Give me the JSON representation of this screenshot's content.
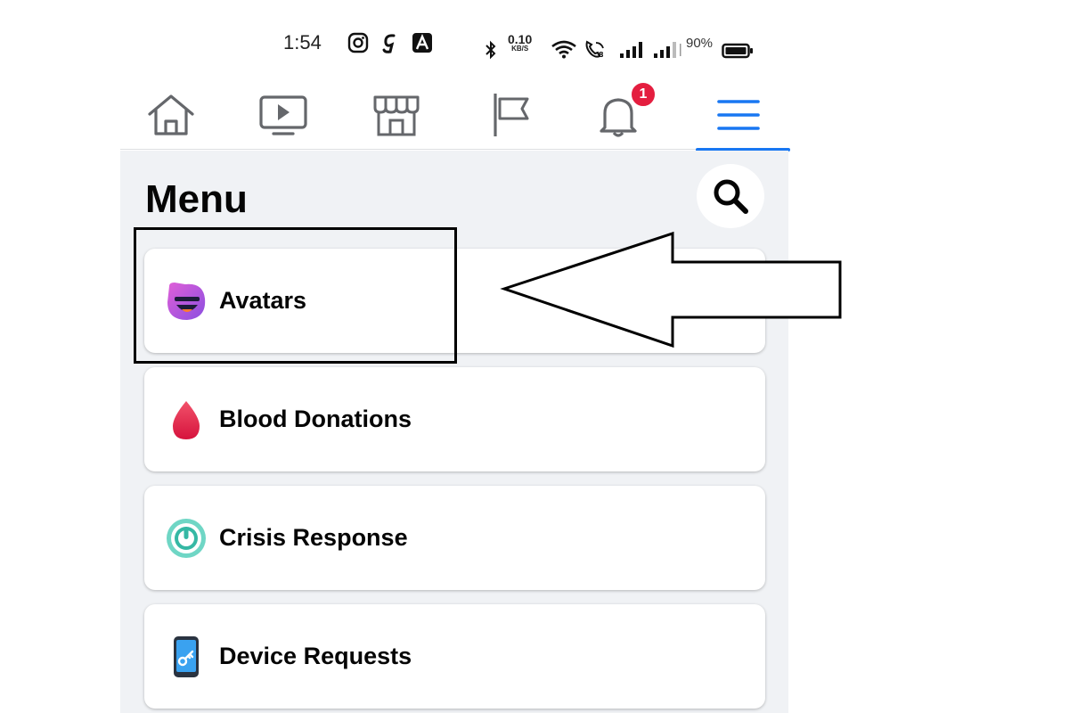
{
  "status_bar": {
    "time": "1:54",
    "net_speed_value": "0.10",
    "net_speed_unit": "KB/S",
    "battery_percent": "90%"
  },
  "nav": {
    "tabs": [
      {
        "name": "home",
        "icon": "home-icon"
      },
      {
        "name": "watch",
        "icon": "video-icon"
      },
      {
        "name": "marketplace",
        "icon": "store-icon"
      },
      {
        "name": "pages",
        "icon": "flag-icon"
      },
      {
        "name": "notifications",
        "icon": "bell-icon"
      },
      {
        "name": "menu",
        "icon": "hamburger-icon",
        "active": true
      }
    ],
    "notification_count": "1"
  },
  "menu": {
    "title": "Menu",
    "items": [
      {
        "label": "Avatars",
        "icon": "avatar-icon"
      },
      {
        "label": "Blood Donations",
        "icon": "blood-drop-icon"
      },
      {
        "label": "Crisis Response",
        "icon": "crisis-response-icon"
      },
      {
        "label": "Device Requests",
        "icon": "device-icon"
      }
    ]
  },
  "colors": {
    "accent": "#1877f2",
    "badge": "#e41e3f",
    "panel_bg": "#f0f2f5"
  }
}
